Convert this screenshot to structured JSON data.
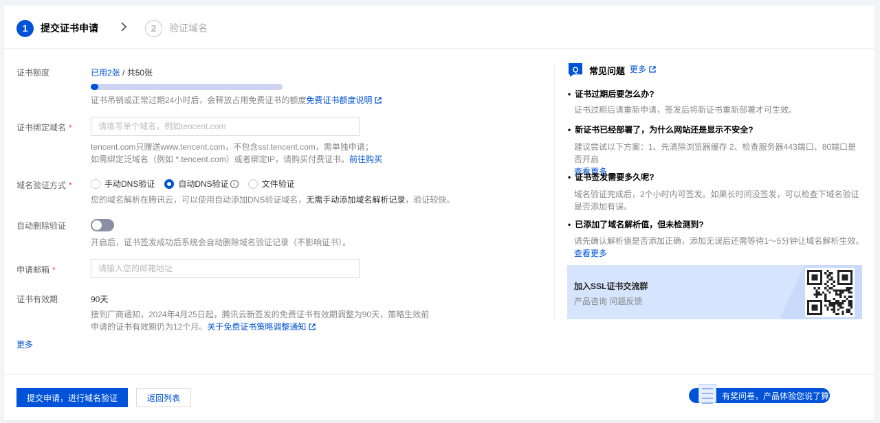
{
  "stepper": {
    "step1": {
      "num": "1",
      "label": "提交证书申请"
    },
    "step2": {
      "num": "2",
      "label": "验证域名"
    }
  },
  "quota": {
    "label": "证书额度",
    "used": "已用2张",
    "total": " / 共50张",
    "progress_fraction": 0.04,
    "help": "证书吊销或正常过期24小时后，会释放占用免费证书的额度",
    "help_link": "免费证书额度说明"
  },
  "domain": {
    "label": "证书绑定域名",
    "required": "*",
    "placeholder": "请填写单个域名，例如tencent.com",
    "help1": "tencent.com只赠送www.tencent.com，不包含ssl.tencent.com，需单独申请；",
    "help2": "如需绑定泛域名（例如 *.tencent.com）或者绑定IP，请购买付费证书。",
    "help2_link": "前往购买"
  },
  "verify": {
    "label": "域名验证方式",
    "required": "*",
    "options": [
      "手动DNS验证",
      "自动DNS验证",
      "文件验证"
    ],
    "info": "i",
    "help_a": "您的域名解析在腾讯云，可以使用自动添加DNS验证域名，",
    "help_b": "无需手动添加域名解析记录",
    "help_c": "，验证较快。"
  },
  "auto_delete": {
    "label": "自动删除验证",
    "help": "开启后，证书签发成功后系统会自动删除域名验证记录（不影响证书）。"
  },
  "email": {
    "label": "申请邮箱",
    "required": "*",
    "placeholder": "请输入您的邮箱地址"
  },
  "validity": {
    "label": "证书有效期",
    "value": "90天",
    "help1": "接到厂商通知，2024年4月25日起，腾讯云新签发的免费证书有效期调整为90天，策略生效前",
    "help2": "申请的证书有效期仍为12个月。",
    "help2_link": "关于免费证书策略调整通知"
  },
  "more": "更多",
  "faq": {
    "icon": "Q",
    "title": "常见问题",
    "more": "更多",
    "items": [
      {
        "q": "证书过期后要怎么办?",
        "a": "证书过期后请重新申请，签发后将新证书重新部署才可生效。",
        "link": ""
      },
      {
        "q": "新证书已经部署了，为什么网站还是显示不安全?",
        "a": "建议尝试以下方案：1、先清除浏览器缓存 2、检查服务器443端口、80端口是否开启",
        "link": "查看更多"
      },
      {
        "q": "证书签发需要多久呢?",
        "a": "域名验证完成后，2个小时内可签发。如果长时间没签发，可以检查下域名验证是否添加有误。",
        "link": ""
      },
      {
        "q": "已添加了域名解析值，但未检测到?",
        "a": "请先确认解析值是否添加正确，添加无误后还需等待1～5分钟让域名解析生效。",
        "link": "查看更多"
      }
    ],
    "promo_title": "加入SSL证书交流群",
    "promo_sub": "产品咨询 问题反馈"
  },
  "footer": {
    "submit": "提交申请，进行域名验证",
    "back": "返回列表",
    "survey": "有奖问卷，产品体验您说了算"
  },
  "colors": {
    "primary": "#0052d9",
    "required": "#e54545"
  }
}
